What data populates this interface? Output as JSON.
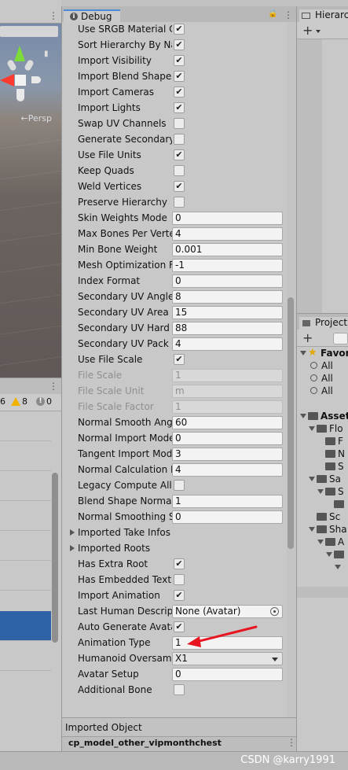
{
  "scene": {
    "persp_label": "←Persp",
    "menu_glyph": "⋮"
  },
  "console": {
    "counts": {
      "log": "6",
      "warnings": "8",
      "errors": "0"
    },
    "menu_glyph": "⋮"
  },
  "inspector": {
    "tab_label": "Debug",
    "menu_glyph": "⋮",
    "rows": [
      {
        "label": "Use SRGB Material C",
        "type": "checkbox",
        "checked": true
      },
      {
        "label": "Sort Hierarchy By Na",
        "type": "checkbox",
        "checked": true
      },
      {
        "label": "Import Visibility",
        "type": "checkbox",
        "checked": true
      },
      {
        "label": "Import Blend Shapes",
        "type": "checkbox",
        "checked": true
      },
      {
        "label": "Import Cameras",
        "type": "checkbox",
        "checked": true
      },
      {
        "label": "Import Lights",
        "type": "checkbox",
        "checked": true
      },
      {
        "label": "Swap UV Channels",
        "type": "checkbox",
        "checked": false
      },
      {
        "label": "Generate Secondary",
        "type": "checkbox",
        "checked": false
      },
      {
        "label": "Use File Units",
        "type": "checkbox",
        "checked": true
      },
      {
        "label": "Keep Quads",
        "type": "checkbox",
        "checked": false
      },
      {
        "label": "Weld Vertices",
        "type": "checkbox",
        "checked": true
      },
      {
        "label": "Preserve Hierarchy",
        "type": "checkbox",
        "checked": false
      },
      {
        "label": "Skin Weights Mode",
        "type": "field",
        "value": "0"
      },
      {
        "label": "Max Bones Per Verte:",
        "type": "field",
        "value": "4"
      },
      {
        "label": "Min Bone Weight",
        "type": "field",
        "value": "0.001"
      },
      {
        "label": "Mesh Optimization Fl",
        "type": "field",
        "value": "-1"
      },
      {
        "label": "Index Format",
        "type": "field",
        "value": "0"
      },
      {
        "label": "Secondary UV Angle",
        "type": "field",
        "value": "8"
      },
      {
        "label": "Secondary UV Area D",
        "type": "field",
        "value": "15"
      },
      {
        "label": "Secondary UV Hard A",
        "type": "field",
        "value": "88"
      },
      {
        "label": "Secondary UV Pack M",
        "type": "field",
        "value": "4"
      },
      {
        "label": "Use File Scale",
        "type": "checkbox",
        "checked": true
      },
      {
        "label": "File Scale",
        "type": "field",
        "value": "1",
        "disabled": true
      },
      {
        "label": "File Scale Unit",
        "type": "field",
        "value": "m",
        "disabled": true
      },
      {
        "label": "File Scale Factor",
        "type": "field",
        "value": "1",
        "disabled": true
      },
      {
        "label": "Normal Smooth Angle",
        "type": "field",
        "value": "60"
      },
      {
        "label": "Normal Import Mode",
        "type": "field",
        "value": "0"
      },
      {
        "label": "Tangent Import Mode",
        "type": "field",
        "value": "3"
      },
      {
        "label": "Normal Calculation M",
        "type": "field",
        "value": "4"
      },
      {
        "label": "Legacy Compute All N",
        "type": "checkbox",
        "checked": false
      },
      {
        "label": "Blend Shape Normal I",
        "type": "field",
        "value": "1"
      },
      {
        "label": "Normal Smoothing Sc",
        "type": "field",
        "value": "0"
      },
      {
        "label": "Imported Take Infos",
        "type": "foldout"
      },
      {
        "label": "Imported Roots",
        "type": "foldout"
      },
      {
        "label": "Has Extra Root",
        "type": "checkbox",
        "checked": true
      },
      {
        "label": "Has Embedded Textu",
        "type": "checkbox",
        "checked": false
      },
      {
        "label": "Import Animation",
        "type": "checkbox",
        "checked": true
      },
      {
        "label": "Last Human Descripti",
        "type": "object",
        "value": "None (Avatar)"
      },
      {
        "label": "Auto Generate Avatar",
        "type": "checkbox",
        "checked": true
      },
      {
        "label": "Animation Type",
        "type": "field",
        "value": "1"
      },
      {
        "label": "Humanoid Oversampl",
        "type": "dropdown",
        "value": "X1"
      },
      {
        "label": "Avatar Setup",
        "type": "field",
        "value": "0"
      },
      {
        "label": "Additional Bone",
        "type": "checkbox",
        "checked": false
      }
    ],
    "footer_label": "Imported Object",
    "asset_name": "cp_model_other_vipmonthchest"
  },
  "hierarchy": {
    "tab_label": "Hierarchy",
    "plus": "+"
  },
  "project": {
    "tab_label": "Project",
    "plus": "+",
    "tree": [
      {
        "label": "Favorites",
        "kind": "favorites",
        "depth": 0,
        "bold": true
      },
      {
        "label": "All",
        "kind": "search",
        "depth": 1
      },
      {
        "label": "All",
        "kind": "search",
        "depth": 1
      },
      {
        "label": "All",
        "kind": "search",
        "depth": 1
      },
      {
        "label": "",
        "kind": "blank",
        "depth": 0
      },
      {
        "label": "Assets",
        "kind": "folder-open",
        "depth": 0,
        "bold": true
      },
      {
        "label": "Flo",
        "kind": "folder-open",
        "depth": 1
      },
      {
        "label": "F",
        "kind": "folder",
        "depth": 2
      },
      {
        "label": "N",
        "kind": "folder",
        "depth": 2
      },
      {
        "label": "S",
        "kind": "folder",
        "depth": 2
      },
      {
        "label": "Sa",
        "kind": "folder-open",
        "depth": 1
      },
      {
        "label": "S",
        "kind": "folder-open",
        "depth": 2
      },
      {
        "label": "",
        "kind": "folder",
        "depth": 3
      },
      {
        "label": "Sc",
        "kind": "folder",
        "depth": 1
      },
      {
        "label": "Sha",
        "kind": "folder-open",
        "depth": 1
      },
      {
        "label": "A",
        "kind": "folder-open",
        "depth": 2
      },
      {
        "label": "",
        "kind": "folder-open",
        "depth": 3
      },
      {
        "label": "",
        "kind": "arrow",
        "depth": 4
      }
    ]
  },
  "status": {
    "watermark": "CSDN @karry1991"
  },
  "colors": {
    "accent": "#4a8ad8",
    "selection": "#2f63a6",
    "annotation": "#e8141f"
  }
}
